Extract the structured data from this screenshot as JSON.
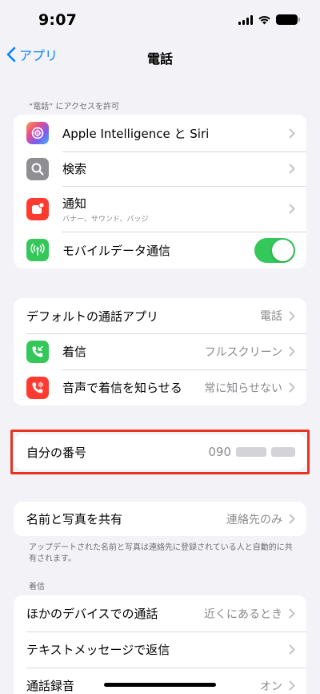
{
  "status_bar": {
    "time": "9:07"
  },
  "nav": {
    "back_label": "アプリ",
    "title": "電話"
  },
  "access_section": {
    "header": "“電話” にアクセスを許可",
    "items": [
      {
        "label": "Apple Intelligence と Siri",
        "icon": "apple-intelligence-icon"
      },
      {
        "label": "検索",
        "icon": "search-icon"
      },
      {
        "label": "通知",
        "sublabel": "バナー、サウンド、バッジ",
        "icon": "notification-icon"
      },
      {
        "label": "モバイルデータ通信",
        "icon": "cellular-icon",
        "toggle": true
      }
    ]
  },
  "call_section": {
    "items": [
      {
        "label": "デフォルトの通話アプリ",
        "value": "電話"
      },
      {
        "label": "着信",
        "value": "フルスクリーン",
        "icon": "incoming-call-icon"
      },
      {
        "label": "音声で着信を知らせる",
        "value": "常に知らせない",
        "icon": "announce-call-icon"
      }
    ]
  },
  "my_number": {
    "label": "自分の番号",
    "value_prefix": "090"
  },
  "share_section": {
    "item": {
      "label": "名前と写真を共有",
      "value": "連絡先のみ"
    },
    "footer": "アップデートされた名前と写真は連絡先に登録されている人と自動的に共有されます。"
  },
  "incoming_section": {
    "header": "着信",
    "items": [
      {
        "label": "ほかのデバイスでの通話",
        "value": "近くにあるとき"
      },
      {
        "label": "テキストメッセージで返信",
        "value": ""
      },
      {
        "label": "通話録音",
        "value": "オン"
      }
    ]
  },
  "colors": {
    "accent": "#0a84ff",
    "toggle_on": "#34c759",
    "notification_red": "#ff3b30",
    "phone_green": "#34c759",
    "search_gray": "#8e8e93",
    "highlight_border": "#e8341f"
  }
}
